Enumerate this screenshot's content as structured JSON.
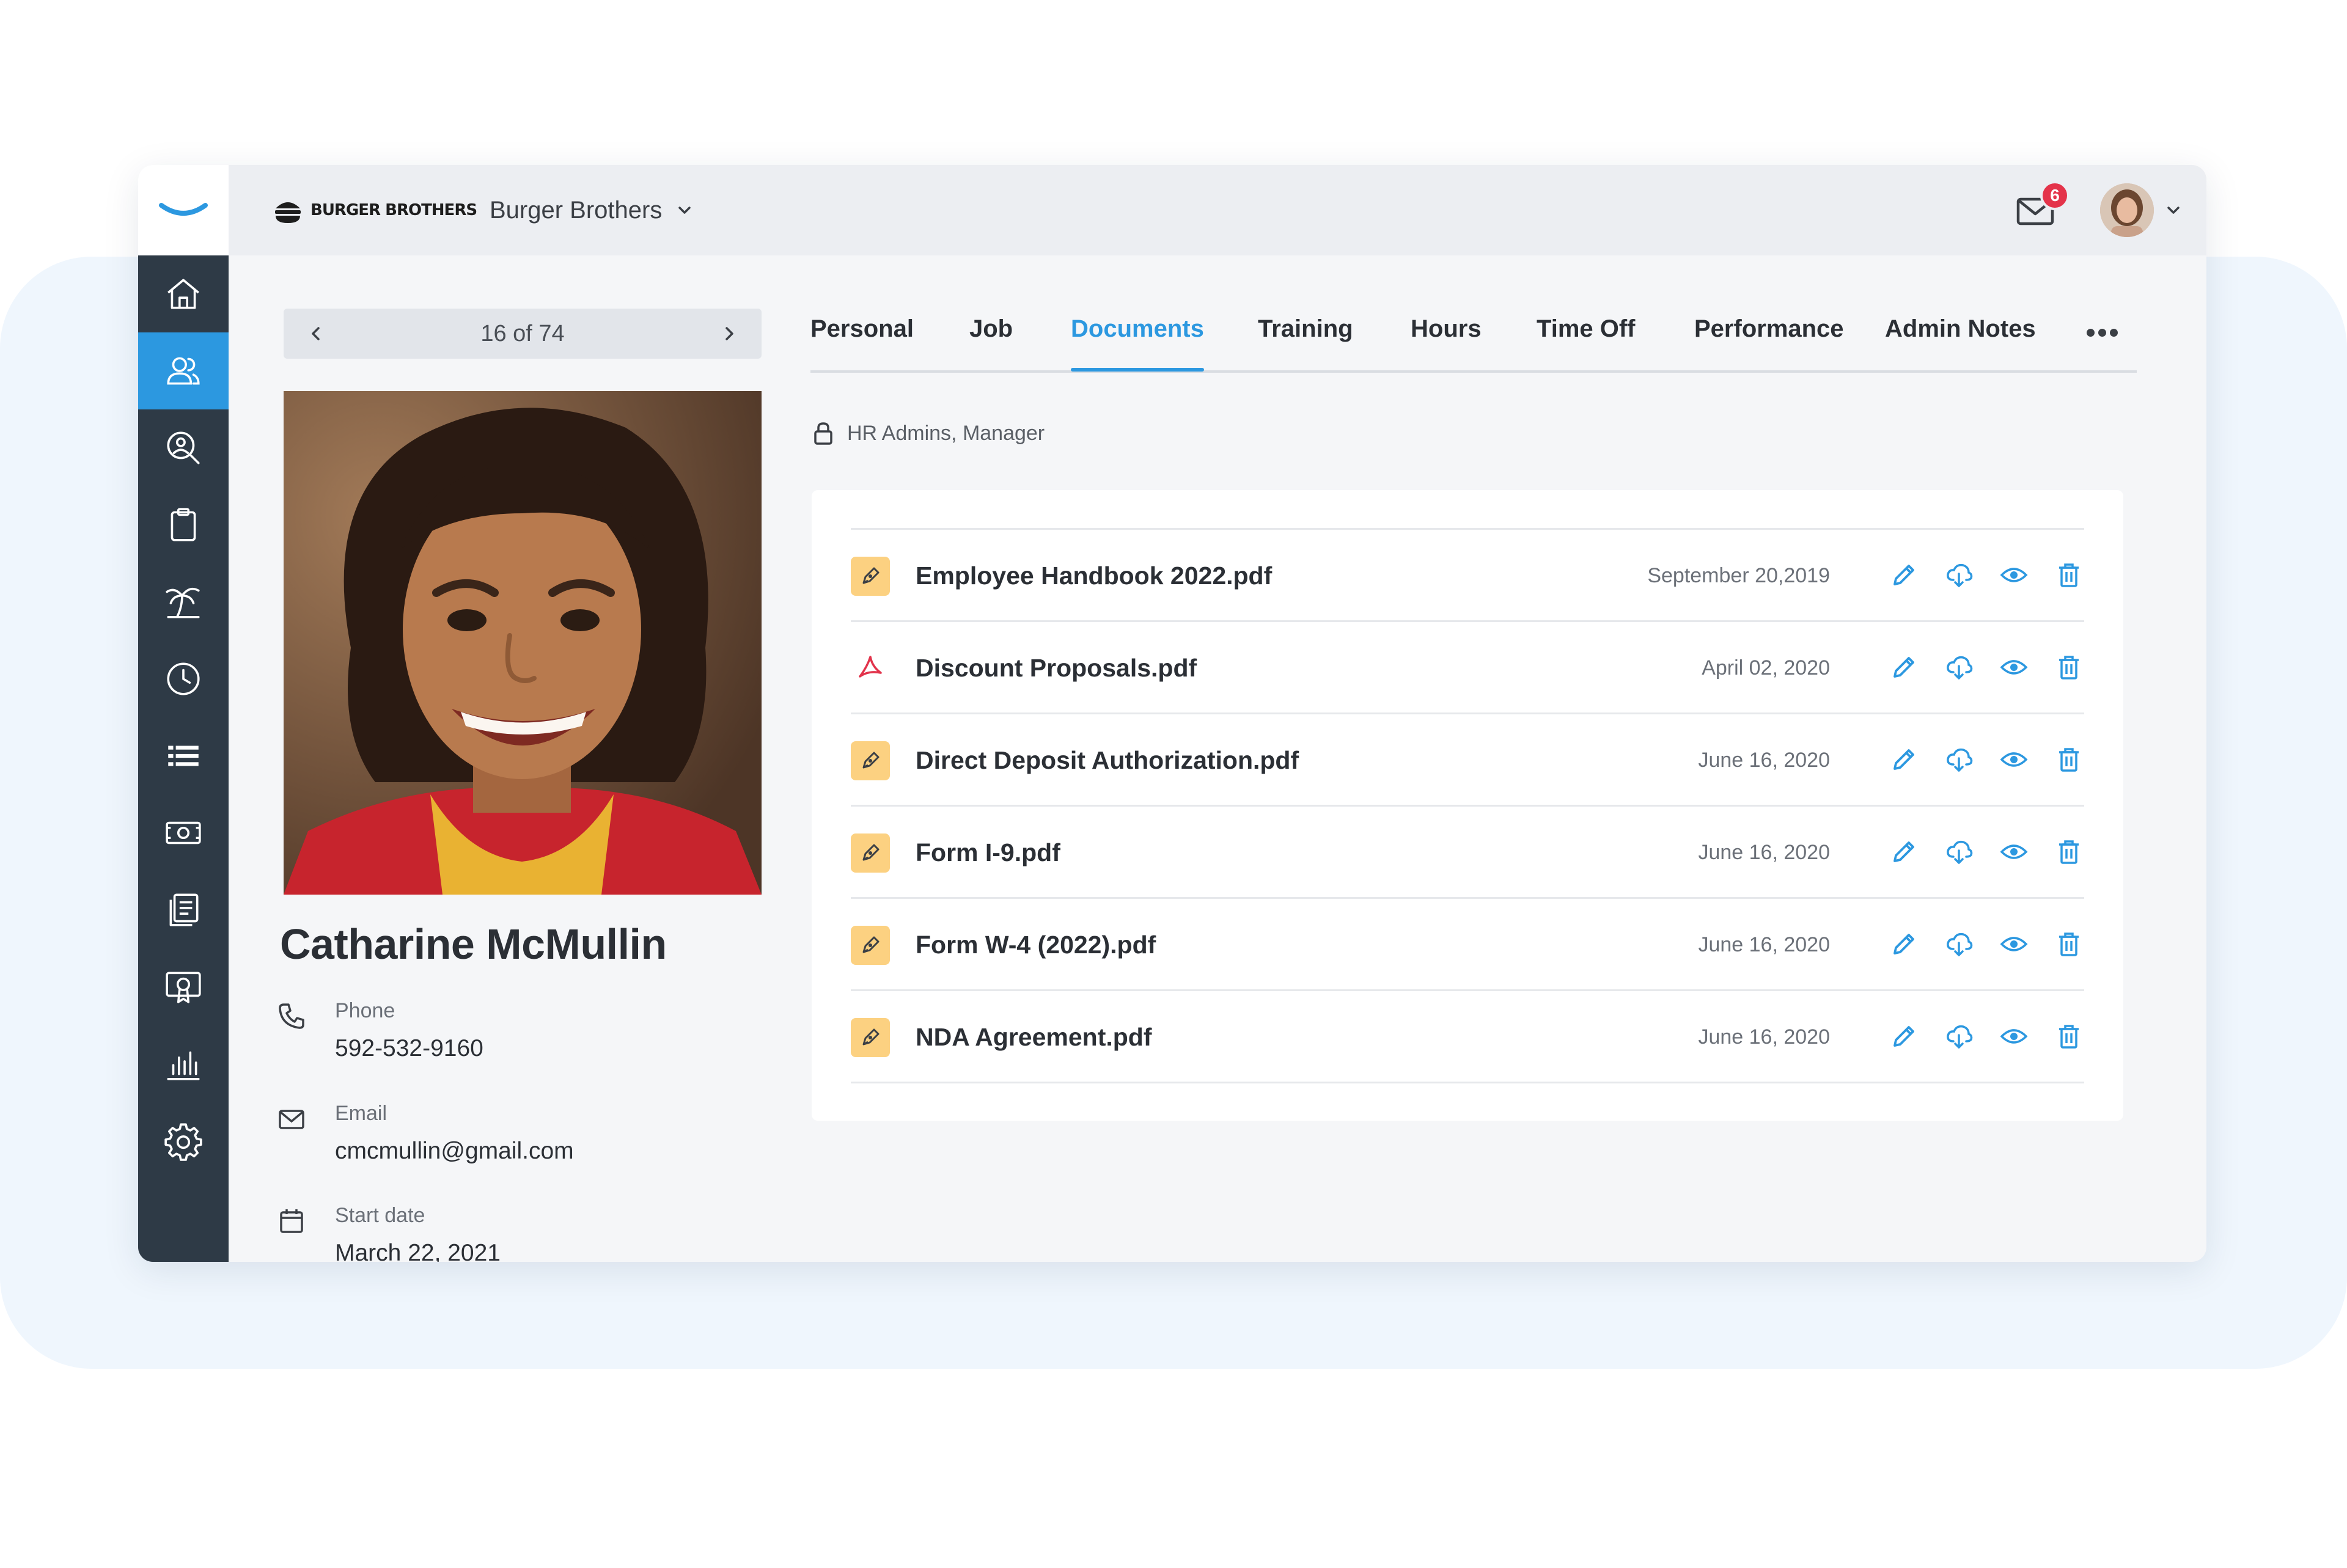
{
  "colors": {
    "accent": "#2c98e0",
    "sidebar": "#2e3a46",
    "badge": "#e4334a",
    "sign_icon_bg": "#fcd181",
    "pdf_red": "#e2334b"
  },
  "header": {
    "company_logo_text": "Burger Brothers",
    "company_name": "Burger Brothers",
    "notification_count": "6",
    "icons": [
      "app-logo-icon",
      "chevron-down-icon",
      "mail-icon",
      "user-avatar",
      "chevron-down-icon"
    ]
  },
  "sidebar": {
    "items": [
      {
        "icon": "home-icon",
        "active": false
      },
      {
        "icon": "users-icon",
        "active": true
      },
      {
        "icon": "search-person-icon",
        "active": false
      },
      {
        "icon": "clipboard-icon",
        "active": false
      },
      {
        "icon": "palm-tree-icon",
        "active": false
      },
      {
        "icon": "clock-icon",
        "active": false
      },
      {
        "icon": "grid-list-icon",
        "active": false
      },
      {
        "icon": "money-icon",
        "active": false
      },
      {
        "icon": "documents-icon",
        "active": false
      },
      {
        "icon": "certificate-icon",
        "active": false
      },
      {
        "icon": "bar-chart-icon",
        "active": false
      },
      {
        "icon": "gear-icon",
        "active": false
      }
    ]
  },
  "profile": {
    "pager": "16 of 74",
    "name": "Catharine McMullin",
    "phone_label": "Phone",
    "phone": "592-532-9160",
    "email_label": "Email",
    "email": "cmcmullin@gmail.com",
    "start_label": "Start date",
    "start": "March 22, 2021"
  },
  "tabs": [
    {
      "label": "Personal"
    },
    {
      "label": "Job"
    },
    {
      "label": "Documents",
      "active": true
    },
    {
      "label": "Training"
    },
    {
      "label": "Hours"
    },
    {
      "label": "Time Off"
    },
    {
      "label": "Performance"
    },
    {
      "label": "Admin Notes"
    }
  ],
  "access": "HR Admins, Manager",
  "documents": [
    {
      "name": "Employee Handbook 2022.pdf",
      "date": "September 20,2019",
      "type": "sign"
    },
    {
      "name": "Discount Proposals.pdf",
      "date": "April 02, 2020",
      "type": "pdf"
    },
    {
      "name": "Direct Deposit Authorization.pdf",
      "date": "June 16, 2020",
      "type": "sign"
    },
    {
      "name": "Form I-9.pdf",
      "date": "June 16, 2020",
      "type": "sign"
    },
    {
      "name": "Form W-4 (2022).pdf",
      "date": "June 16, 2020",
      "type": "sign"
    },
    {
      "name": "NDA Agreement.pdf",
      "date": "June 16, 2020",
      "type": "sign"
    }
  ],
  "row_actions": [
    "edit-icon",
    "download-icon",
    "view-icon",
    "delete-icon"
  ]
}
